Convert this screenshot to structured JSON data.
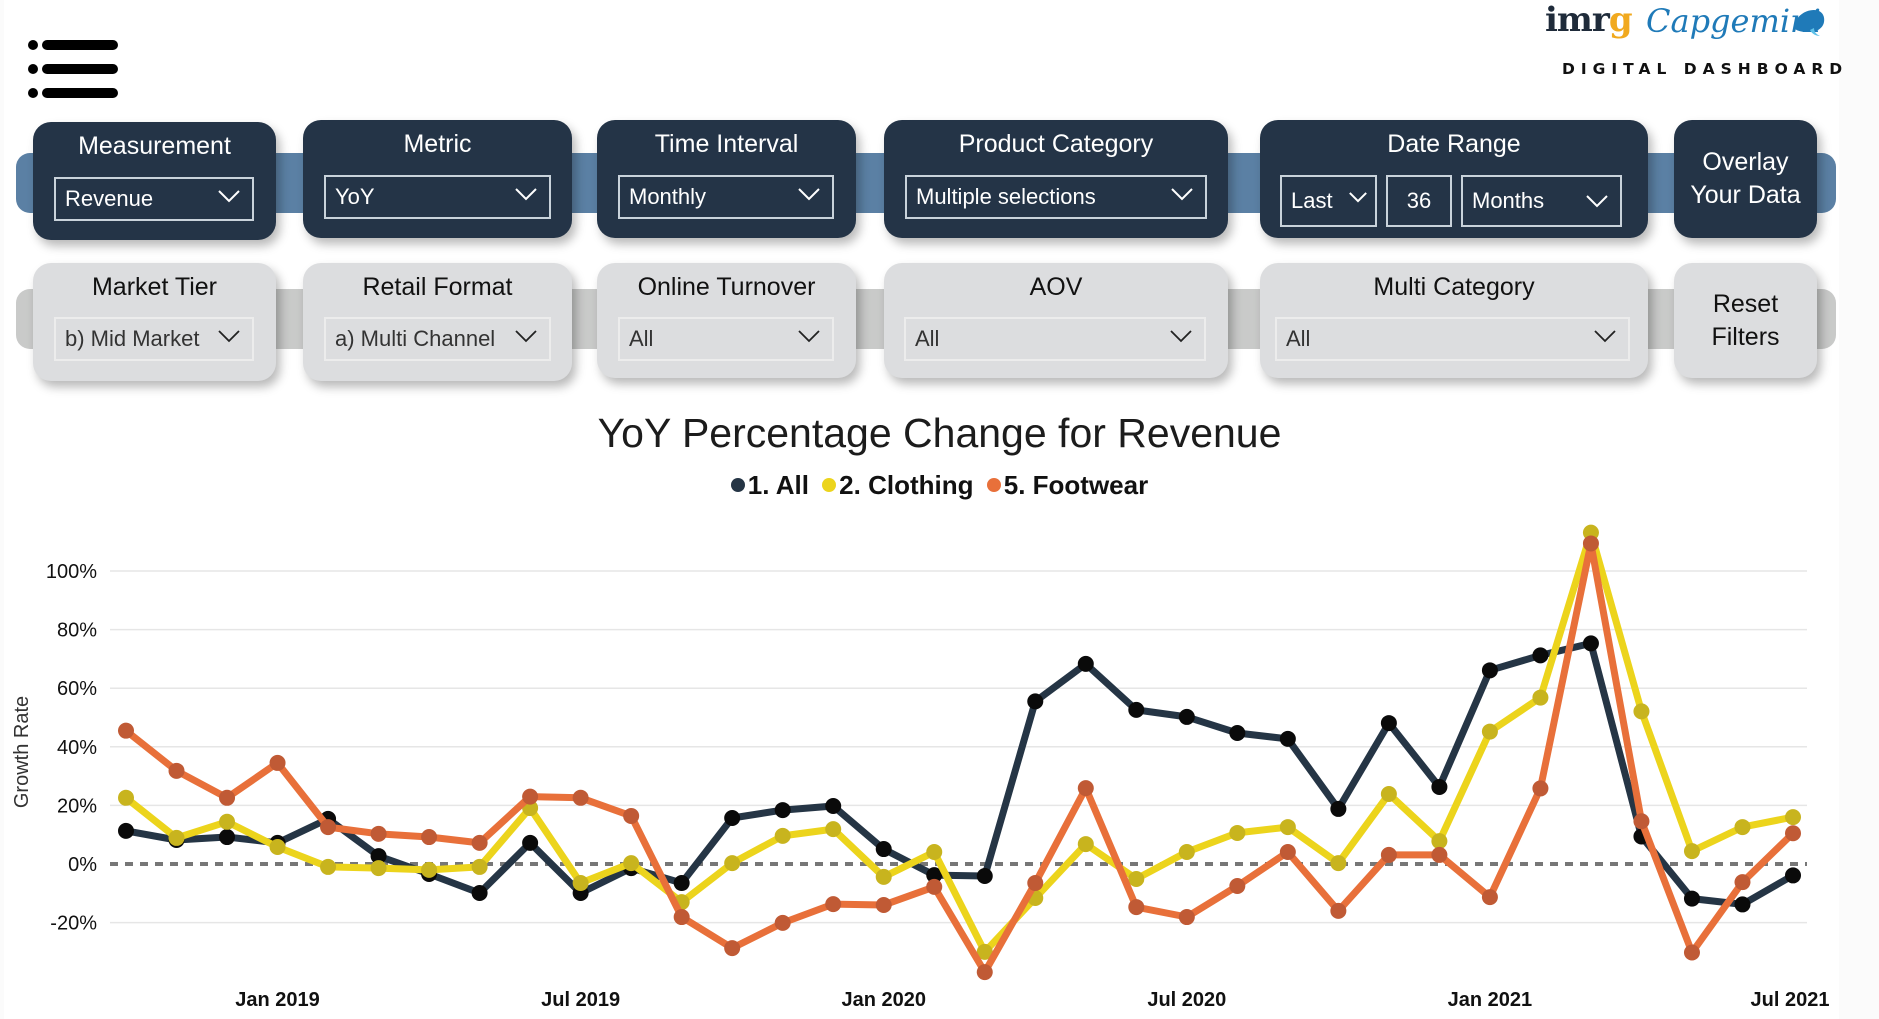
{
  "header": {
    "logo_imrg_main": "imr",
    "logo_imrg_accent": "g",
    "logo_capgemini": "Capgemini",
    "logo_subtitle": "DIGITAL DASHBOARD",
    "menu_icon": "hamburger-menu-icon"
  },
  "filters_primary": [
    {
      "label": "Measurement",
      "value": "Revenue"
    },
    {
      "label": "Metric",
      "value": "YoY"
    },
    {
      "label": "Time Interval",
      "value": "Monthly"
    },
    {
      "label": "Product Category",
      "value": "Multiple selections"
    }
  ],
  "date_range": {
    "label": "Date Range",
    "mode": "Last",
    "count": "36",
    "unit": "Months"
  },
  "overlay_button": {
    "line1": "Overlay",
    "line2": "Your Data"
  },
  "filters_secondary": [
    {
      "label": "Market Tier",
      "value": "b) Mid Market"
    },
    {
      "label": "Retail Format",
      "value": "a) Multi Channel"
    },
    {
      "label": "Online Turnover",
      "value": "All"
    },
    {
      "label": "AOV",
      "value": "All"
    },
    {
      "label": "Multi Category",
      "value": "All"
    }
  ],
  "reset_button": {
    "line1": "Reset",
    "line2": "Filters"
  },
  "colors": {
    "card_dark": "#243447",
    "card_light": "#dcdddf",
    "band_blue": "#5b80a4",
    "band_gray": "#c9cac9",
    "series_all_line": "#253545",
    "series_all_marker": "#0a0a0a",
    "series_clothing_line": "#ecd41c",
    "series_clothing_marker": "#c8b41e",
    "series_footwear_line": "#e8703a",
    "series_footwear_marker": "#c05a35"
  },
  "chart_data": {
    "type": "line",
    "title": "YoY Percentage Change for Revenue",
    "xlabel": "",
    "ylabel": "Growth Rate",
    "ylim": [
      -30,
      115
    ],
    "yticks": [
      -20,
      0,
      20,
      40,
      60,
      80,
      100
    ],
    "ytick_labels": [
      "-20%",
      "0%",
      "20%",
      "40%",
      "60%",
      "80%",
      "100%"
    ],
    "xtick_labels": [
      {
        "label": "Jan 2019",
        "index": 3
      },
      {
        "label": "Jul 2019",
        "index": 9
      },
      {
        "label": "Jan 2020",
        "index": 15
      },
      {
        "label": "Jul 2020",
        "index": 21
      },
      {
        "label": "Jan 2021",
        "index": 27
      },
      {
        "label": "Jul 2021",
        "index": 33
      }
    ],
    "grid": true,
    "zero_line": "dashed",
    "legend_position": "top-center",
    "x": [
      "Oct 2018",
      "Nov 2018",
      "Dec 2018",
      "Jan 2019",
      "Feb 2019",
      "Mar 2019",
      "Apr 2019",
      "May 2019",
      "Jun 2019",
      "Jul 2019",
      "Aug 2019",
      "Sep 2019",
      "Oct 2019",
      "Nov 2019",
      "Dec 2019",
      "Jan 2020",
      "Feb 2020",
      "Mar 2020",
      "Apr 2020",
      "May 2020",
      "Jun 2020",
      "Jul 2020",
      "Aug 2020",
      "Sep 2020",
      "Oct 2020",
      "Nov 2020",
      "Dec 2020",
      "Jan 2021",
      "Feb 2021",
      "Mar 2021",
      "Apr 2021",
      "May 2021",
      "Jun 2021",
      "Jul 2021"
    ],
    "series": [
      {
        "name": "1. All",
        "key": "all",
        "values": [
          11.3,
          8.2,
          9.2,
          7.2,
          15.4,
          2.7,
          -3.4,
          -9.9,
          7.2,
          -9.9,
          -1.4,
          -6.5,
          15.7,
          18.4,
          19.8,
          5.1,
          -3.8,
          -4.1,
          55.5,
          68.3,
          52.6,
          50.2,
          44.7,
          42.7,
          18.8,
          48.1,
          26.3,
          66.1,
          71.2,
          75.3,
          9.4,
          -11.8,
          -13.8,
          -3.9
        ]
      },
      {
        "name": "2. Clothing",
        "key": "clothing",
        "values": [
          22.6,
          8.9,
          14.4,
          5.8,
          -1.0,
          -1.4,
          -2.0,
          -1.0,
          19.1,
          -6.5,
          0.3,
          -13.0,
          0.3,
          9.6,
          11.9,
          -4.4,
          4.1,
          -30.0,
          -11.6,
          6.8,
          -5.1,
          4.1,
          10.6,
          12.6,
          0.3,
          23.9,
          7.8,
          45.2,
          56.8,
          113.1,
          52.1,
          4.4,
          12.6,
          16.0
        ]
      },
      {
        "name": "5. Footwear",
        "key": "footwear",
        "values": [
          45.5,
          31.8,
          22.6,
          34.5,
          12.6,
          10.3,
          9.2,
          7.2,
          23.0,
          22.6,
          16.4,
          -18.1,
          -28.7,
          -20.1,
          -13.7,
          -14.0,
          -7.8,
          -36.9,
          -6.5,
          25.9,
          -14.7,
          -18.1,
          -7.5,
          4.1,
          -16.0,
          3.1,
          3.1,
          -11.3,
          25.8,
          109.4,
          14.6,
          -30.2,
          -6.2,
          10.5
        ]
      }
    ]
  }
}
